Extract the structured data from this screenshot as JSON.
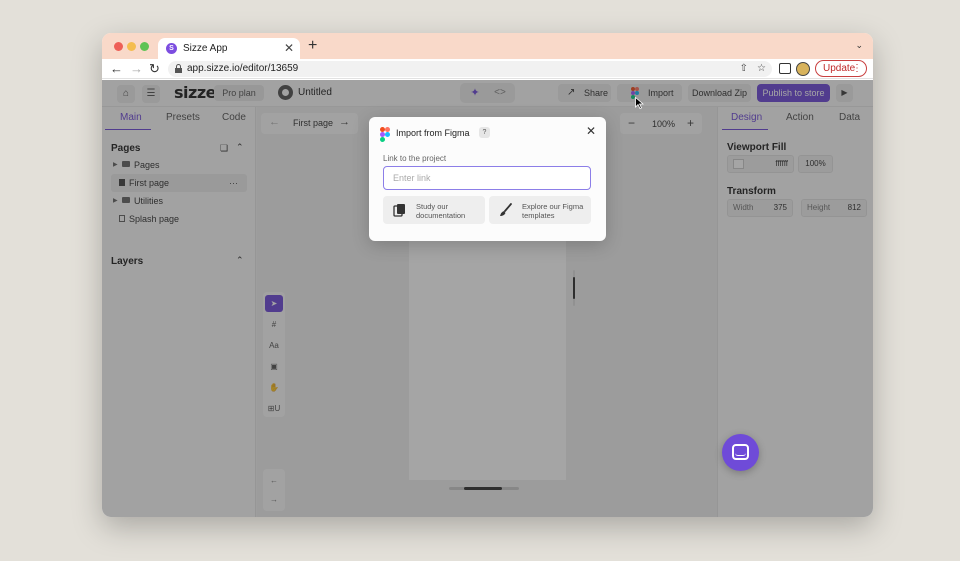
{
  "browser": {
    "tab_title": "Sizze App",
    "tab_favicon": "S",
    "url": "app.sizze.io/editor/13659",
    "update_label": "Update",
    "new_tab": "+",
    "tab_close": "✕"
  },
  "header": {
    "logo": "sizze",
    "plan": "Pro plan",
    "project_title": "Untitled",
    "share_label": "Share",
    "import_label": "Import",
    "download_label": "Download Zip",
    "publish_label": "Publish to store"
  },
  "left_panel": {
    "tabs": [
      "Main",
      "Presets",
      "Code"
    ],
    "pages_title": "Pages",
    "layers_title": "Layers",
    "tree": [
      {
        "label": "Pages"
      },
      {
        "label": "First page"
      },
      {
        "label": "Utilities"
      },
      {
        "label": "Splash page"
      }
    ]
  },
  "canvas": {
    "current_page": "First page",
    "zoom": "100%",
    "tools": [
      "select-tool",
      "frame-tool",
      "text-tool",
      "image-tool",
      "hand-tool",
      "component-tool"
    ],
    "text_tool_label": "Aa",
    "component_tool_label": "⊞U"
  },
  "right_panel": {
    "tabs": [
      "Design",
      "Action",
      "Data"
    ],
    "viewport_fill_title": "Viewport Fill",
    "fill_hex": "ffffff",
    "fill_opacity": "100%",
    "transform_title": "Transform",
    "width_label": "Width",
    "width_value": "375",
    "height_label": "Height",
    "height_value": "812"
  },
  "modal": {
    "title": "Import from Figma",
    "help": "?",
    "link_label": "Link to the project",
    "input_placeholder": "Enter link",
    "input_value": "",
    "card_doc": "Study our documentation",
    "card_templates": "Explore our Figma templates"
  },
  "colors": {
    "accent": "#6f4bd8",
    "tab_strip": "#f9d9c9",
    "update": "#c02b2b"
  }
}
